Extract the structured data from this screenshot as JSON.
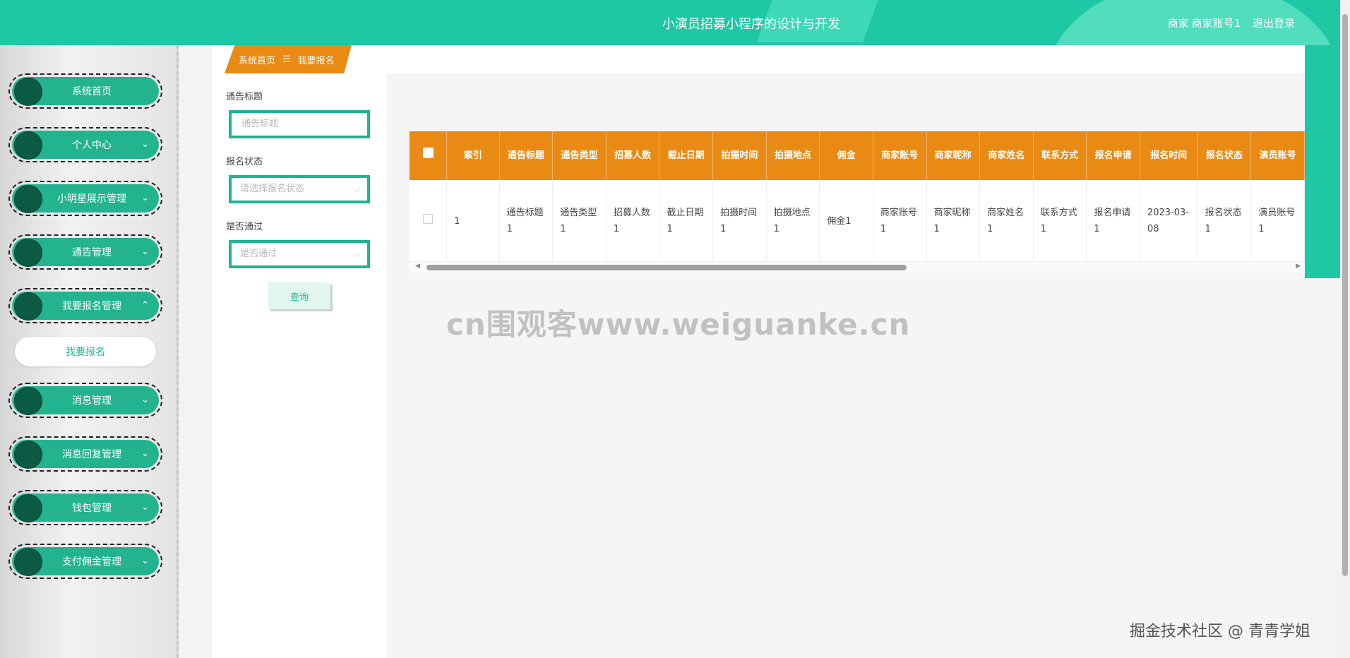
{
  "header": {
    "title": "小演员招募小程序的设计与开发",
    "role": "商家",
    "account": "商家账号1",
    "logout": "退出登录"
  },
  "sidebar": {
    "items": [
      {
        "label": "系统首页",
        "chevron": ""
      },
      {
        "label": "个人中心",
        "chevron": "⌄"
      },
      {
        "label": "小明星展示管理",
        "chevron": "⌄"
      },
      {
        "label": "通告管理",
        "chevron": "⌄"
      },
      {
        "label": "我要报名管理",
        "chevron": "⌃"
      },
      {
        "label": "消息管理",
        "chevron": "⌄"
      },
      {
        "label": "消息回复管理",
        "chevron": "⌄"
      },
      {
        "label": "钱包管理",
        "chevron": "⌄"
      },
      {
        "label": "支付佣金管理",
        "chevron": "⌄"
      }
    ],
    "active_sub": "我要报名"
  },
  "breadcrumb": {
    "home": "系统首页",
    "separator": "☰",
    "current": "我要报名"
  },
  "search": {
    "title_label": "通告标题",
    "title_placeholder": "通告标题",
    "status_label": "报名状态",
    "status_placeholder": "请选择报名状态",
    "pass_label": "是否通过",
    "pass_placeholder": "是否通过",
    "query_button": "查询"
  },
  "table": {
    "headers": [
      "索引",
      "通告标题",
      "通告类型",
      "招募人数",
      "截止日期",
      "拍摄时间",
      "拍摄地点",
      "佣金",
      "商家账号",
      "商家昵称",
      "商家姓名",
      "联系方式",
      "报名申请",
      "报名时间",
      "报名状态",
      "演员账号"
    ],
    "rows": [
      [
        "1",
        "通告标题1",
        "通告类型1",
        "招募人数1",
        "截止日期1",
        "拍摄时间1",
        "拍摄地点1",
        "佣金1",
        "商家账号1",
        "商家昵称1",
        "商家姓名1",
        "联系方式1",
        "报名申请1",
        "2023-03-08",
        "报名状态1",
        "演员账号1"
      ]
    ]
  },
  "watermarks": {
    "center": "cn围观客www.weiguanke.cn",
    "corner": "掘金技术社区 @ 青青学姐"
  },
  "colors": {
    "accent": "#1fc8a4",
    "menu": "#23b38f",
    "table_header": "#e98a14"
  }
}
